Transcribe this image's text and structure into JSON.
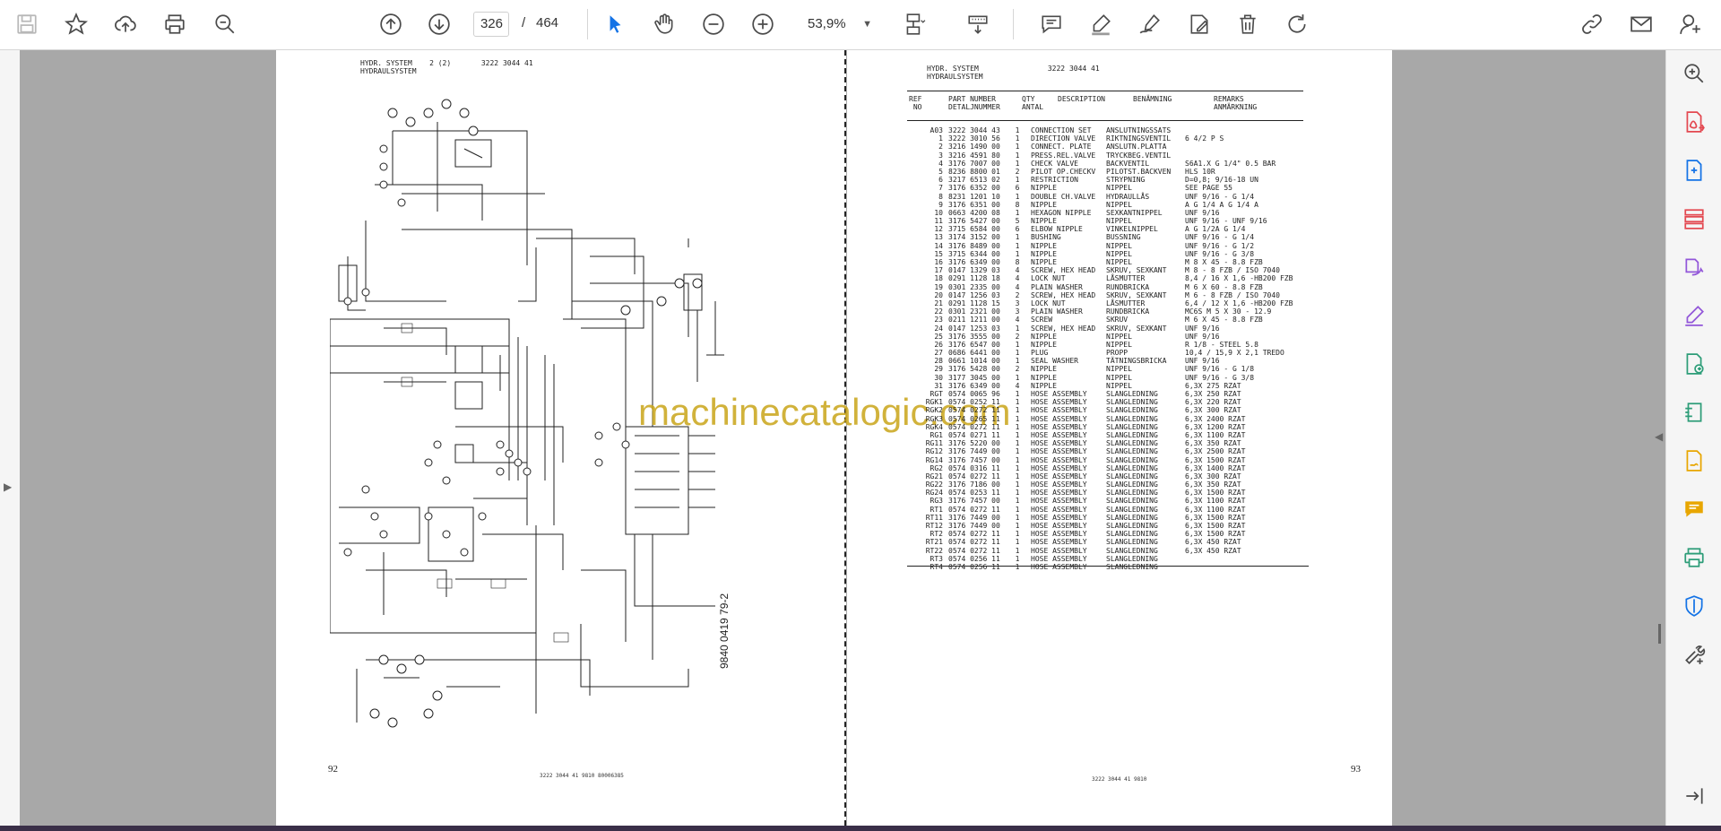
{
  "toolbar": {
    "page_current": "326",
    "page_separator": "/",
    "page_total": "464",
    "zoom": "53,9%",
    "icons": [
      "save-icon",
      "bookmark-star-icon",
      "upload-icon",
      "print-icon",
      "find-zoom-icon",
      "page-up-icon",
      "page-down-icon",
      "select-cursor-icon",
      "hand-tool-icon",
      "zoom-out-icon",
      "zoom-in-icon",
      "page-fit-icon",
      "scroll-mode-icon",
      "comment-icon",
      "highlight-icon",
      "sign-icon",
      "fill-sign-icon",
      "delete-icon",
      "rotate-icon",
      "share-link-icon",
      "email-icon",
      "account-icon"
    ]
  },
  "left_page": {
    "header_line1": "HYDR. SYSTEM    2 (2)       3222 3044 41",
    "header_line2": "HYDRAULSYSTEM",
    "page_number": "92",
    "footer": "3222 3044 41   9810  80006385",
    "drawing_number": "9840 0419 79-2"
  },
  "right_page": {
    "header_line1": "HYDR. SYSTEM                3222 3044 41",
    "header_line2": "HYDRAULSYSTEM",
    "page_number": "93",
    "footer": "3222 3044 41   9810",
    "table_header": {
      "ref": "REF\n NO",
      "part": "PART NUMBER\nDETALJNUMMER",
      "qty": "QTY\nANTAL",
      "desc": "DESCRIPTION",
      "ben": "BENÄMNING",
      "rem": "REMARKS\nANMÄRKNING"
    },
    "rows": [
      [
        "A03",
        "3222 3044 43",
        "1",
        "CONNECTION SET",
        "ANSLUTNINGSSATS",
        ""
      ],
      [
        "1",
        "3222 3010 56",
        "1",
        "DIRECTION VALVE",
        "RIKTNINGSVENTIL",
        "6   4/2     P S"
      ],
      [
        "2",
        "3216 1490 00",
        "1",
        "CONNECT. PLATE",
        "ANSLUTN.PLATTA",
        ""
      ],
      [
        "3",
        "3216 4591 80",
        "1",
        "PRESS.REL.VALVE",
        "TRYCKBEG.VENTIL",
        ""
      ],
      [
        "4",
        "3176 7007 00",
        "1",
        "CHECK VALVE",
        "BACKVENTIL",
        "S6A1.X G 1/4\" 0.5 BAR"
      ],
      [
        "5",
        "8236 8800 01",
        "2",
        "PILOT OP.CHECKV",
        "PILOTST.BACKVEN",
        "HLS 10R"
      ],
      [
        "6",
        "3217 6513 02",
        "1",
        "RESTRICTION",
        "STRYPNING",
        "D=0,8; 9/16-18 UN"
      ],
      [
        "7",
        "3176 6352 00",
        "6",
        "NIPPLE",
        "NIPPEL",
        "SEE PAGE 55"
      ],
      [
        "8",
        "8231 1201 10",
        "1",
        "DOUBLE CH.VALVE",
        "HYDRAULLÅS",
        "UNF  9/16 - G 1/4"
      ],
      [
        "9",
        "3176 6351 00",
        "8",
        "NIPPLE",
        "NIPPEL",
        "  A   G  1/4 A  G   1/4 A"
      ],
      [
        "10",
        "0663 4200 08",
        "1",
        "HEXAGON NIPPLE",
        "SEXKANTNIPPEL",
        "UNF  9/16"
      ],
      [
        "11",
        "3176 5427 00",
        "5",
        "NIPPLE",
        "NIPPEL",
        "UNF  9/16 - UNF 9/16"
      ],
      [
        "12",
        "3715 6584 00",
        "6",
        "ELBOW NIPPLE",
        "VINKELNIPPEL",
        "A G 1/2A G  1/4"
      ],
      [
        "13",
        "3174 3152 00",
        "1",
        "BUSHING",
        "BUSSNING",
        "UNF  9/16 - G 1/4"
      ],
      [
        "14",
        "3176 8489 00",
        "1",
        "NIPPLE",
        "NIPPEL",
        "UNF  9/16 - G 1/2"
      ],
      [
        "15",
        "3715 6344 00",
        "1",
        "NIPPLE",
        "NIPPEL",
        "UNF  9/16 - G 3/8"
      ],
      [
        "16",
        "3176 6349 00",
        "8",
        "NIPPLE",
        "NIPPEL",
        "M 8 X 45 - 8.8 FZB"
      ],
      [
        "17",
        "0147 1329 03",
        "4",
        "SCREW, HEX HEAD",
        "SKRUV, SEXKANT",
        "M  8 - 8 FZB / ISO 7040"
      ],
      [
        "18",
        "0291 1128 18",
        "4",
        "LOCK NUT",
        "LÅSMUTTER",
        "8,4 / 16 X 1,6 -HB200 FZB"
      ],
      [
        "19",
        "0301 2335 00",
        "4",
        "PLAIN WASHER",
        "RUNDBRICKA",
        "M 6 X 60 - 8.8 FZB"
      ],
      [
        "20",
        "0147 1256 03",
        "2",
        "SCREW, HEX HEAD",
        "SKRUV, SEXKANT",
        "M  6 - 8 FZB / ISO 7040"
      ],
      [
        "21",
        "0291 1128 15",
        "3",
        "LOCK NUT",
        "LÅSMUTTER",
        "6,4 / 12 X 1,6 -HB200 FZB"
      ],
      [
        "22",
        "0301 2321 00",
        "3",
        "PLAIN WASHER",
        "RUNDBRICKA",
        "MC6S M 5 X 30 - 12.9"
      ],
      [
        "23",
        "0211 1211 00",
        "4",
        "SCREW",
        "SKRUV",
        "M 6 X 45 - 8.8 FZB"
      ],
      [
        "24",
        "0147 1253 03",
        "1",
        "SCREW, HEX HEAD",
        "SKRUV, SEXKANT",
        "UNF  9/16"
      ],
      [
        "25",
        "3176 3555 00",
        "2",
        "NIPPLE",
        "NIPPEL",
        "UNF  9/16"
      ],
      [
        "26",
        "3176 6547 00",
        "1",
        "NIPPLE",
        "NIPPEL",
        "R 1/8 - STEEL 5.8"
      ],
      [
        "27",
        "0686 6441 00",
        "1",
        "PLUG",
        "PROPP",
        "10,4 / 15,9 X 2,1 TREDO"
      ],
      [
        "28",
        "0661 1014 00",
        "1",
        "SEAL WASHER",
        "TÄTNINGSBRICKA",
        "UNF  9/16"
      ],
      [
        "29",
        "3176 5428 00",
        "2",
        "NIPPLE",
        "NIPPEL",
        "UNF  9/16 - G 1/8"
      ],
      [
        "30",
        "3177 3045 00",
        "1",
        "NIPPLE",
        "NIPPEL",
        "UNF  9/16 - G 3/8"
      ],
      [
        "31",
        "3176 6349 00",
        "4",
        "NIPPLE",
        "NIPPEL",
        "6,3X  275 RZAT"
      ],
      [
        "RGT",
        "0574 0065 96",
        "1",
        "HOSE ASSEMBLY",
        "SLANGLEDNING",
        "6,3X  250 RZAT"
      ],
      [
        "RGK1",
        "0574 0252 11",
        "1",
        "HOSE ASSEMBLY",
        "SLANGLEDNING",
        "6,3X  220 RZAT"
      ],
      [
        "RGK2",
        "0574 0272 11",
        "1",
        "HOSE ASSEMBLY",
        "SLANGLEDNING",
        "6,3X  300 RZAT"
      ],
      [
        "RGK3",
        "0574 0265 11",
        "1",
        "HOSE ASSEMBLY",
        "SLANGLEDNING",
        "6,3X 2400 RZAT"
      ],
      [
        "RGK4",
        "0574 0272 11",
        "1",
        "HOSE ASSEMBLY",
        "SLANGLEDNING",
        "6,3X 1200 RZAT"
      ],
      [
        "RG1",
        "0574 0271 11",
        "1",
        "HOSE ASSEMBLY",
        "SLANGLEDNING",
        "6,3X 1100 RZAT"
      ],
      [
        "RG11",
        "3176 5220 00",
        "1",
        "HOSE ASSEMBLY",
        "SLANGLEDNING",
        "6,3X  350 RZAT"
      ],
      [
        "RG12",
        "3176 7449 00",
        "1",
        "HOSE ASSEMBLY",
        "SLANGLEDNING",
        "6,3X 2500 RZAT"
      ],
      [
        "RG14",
        "3176 7457 00",
        "1",
        "HOSE ASSEMBLY",
        "SLANGLEDNING",
        "6,3X 1500 RZAT"
      ],
      [
        "RG2",
        "0574 0316 11",
        "1",
        "HOSE ASSEMBLY",
        "SLANGLEDNING",
        "6,3X 1400 RZAT"
      ],
      [
        "RG21",
        "0574 0272 11",
        "1",
        "HOSE ASSEMBLY",
        "SLANGLEDNING",
        "6,3X  300 RZAT"
      ],
      [
        "RG22",
        "3176 7186 00",
        "1",
        "HOSE ASSEMBLY",
        "SLANGLEDNING",
        "6,3X  350 RZAT"
      ],
      [
        "RG24",
        "0574 0253 11",
        "1",
        "HOSE ASSEMBLY",
        "SLANGLEDNING",
        "6,3X 1500 RZAT"
      ],
      [
        "RG3",
        "3176 7457 00",
        "1",
        "HOSE ASSEMBLY",
        "SLANGLEDNING",
        "6,3X 1100 RZAT"
      ],
      [
        "RT1",
        "0574 0272 11",
        "1",
        "HOSE ASSEMBLY",
        "SLANGLEDNING",
        "6,3X 1100 RZAT"
      ],
      [
        "RT11",
        "3176 7449 00",
        "1",
        "HOSE ASSEMBLY",
        "SLANGLEDNING",
        "6,3X 1500 RZAT"
      ],
      [
        "RT12",
        "3176 7449 00",
        "1",
        "HOSE ASSEMBLY",
        "SLANGLEDNING",
        "6,3X 1500 RZAT"
      ],
      [
        "RT2",
        "0574 0272 11",
        "1",
        "HOSE ASSEMBLY",
        "SLANGLEDNING",
        "6,3X 1500 RZAT"
      ],
      [
        "RT21",
        "0574 0272 11",
        "1",
        "HOSE ASSEMBLY",
        "SLANGLEDNING",
        "6,3X  450 RZAT"
      ],
      [
        "RT22",
        "0574 0272 11",
        "1",
        "HOSE ASSEMBLY",
        "SLANGLEDNING",
        "6,3X  450 RZAT"
      ],
      [
        "RT3",
        "0574 0256 11",
        "1",
        "HOSE ASSEMBLY",
        "SLANGLEDNING",
        ""
      ],
      [
        "RT4",
        "0574 0256 11",
        "1",
        "HOSE ASSEMBLY",
        "SLANGLEDNING",
        ""
      ]
    ]
  },
  "watermark": "machinecatalogic.com",
  "right_panel_icons": [
    "search-zoom-icon",
    "export-pdf-icon",
    "create-pdf-icon",
    "organize-pages-icon",
    "combine-files-icon",
    "edit-pdf-icon",
    "convert-pdf-icon",
    "compress-icon",
    "request-signature-icon",
    "comment-panel-icon",
    "print-production-icon",
    "protect-shield-icon",
    "more-tools-icon",
    "expand-panel-icon"
  ],
  "colors": {
    "accent_blue": "#1473e6",
    "red_tool": "#e34850",
    "purple_tool": "#9256d9",
    "green_tool": "#2d9d78",
    "yellow_tool": "#e8a600",
    "watermark": "#c9a51a"
  }
}
